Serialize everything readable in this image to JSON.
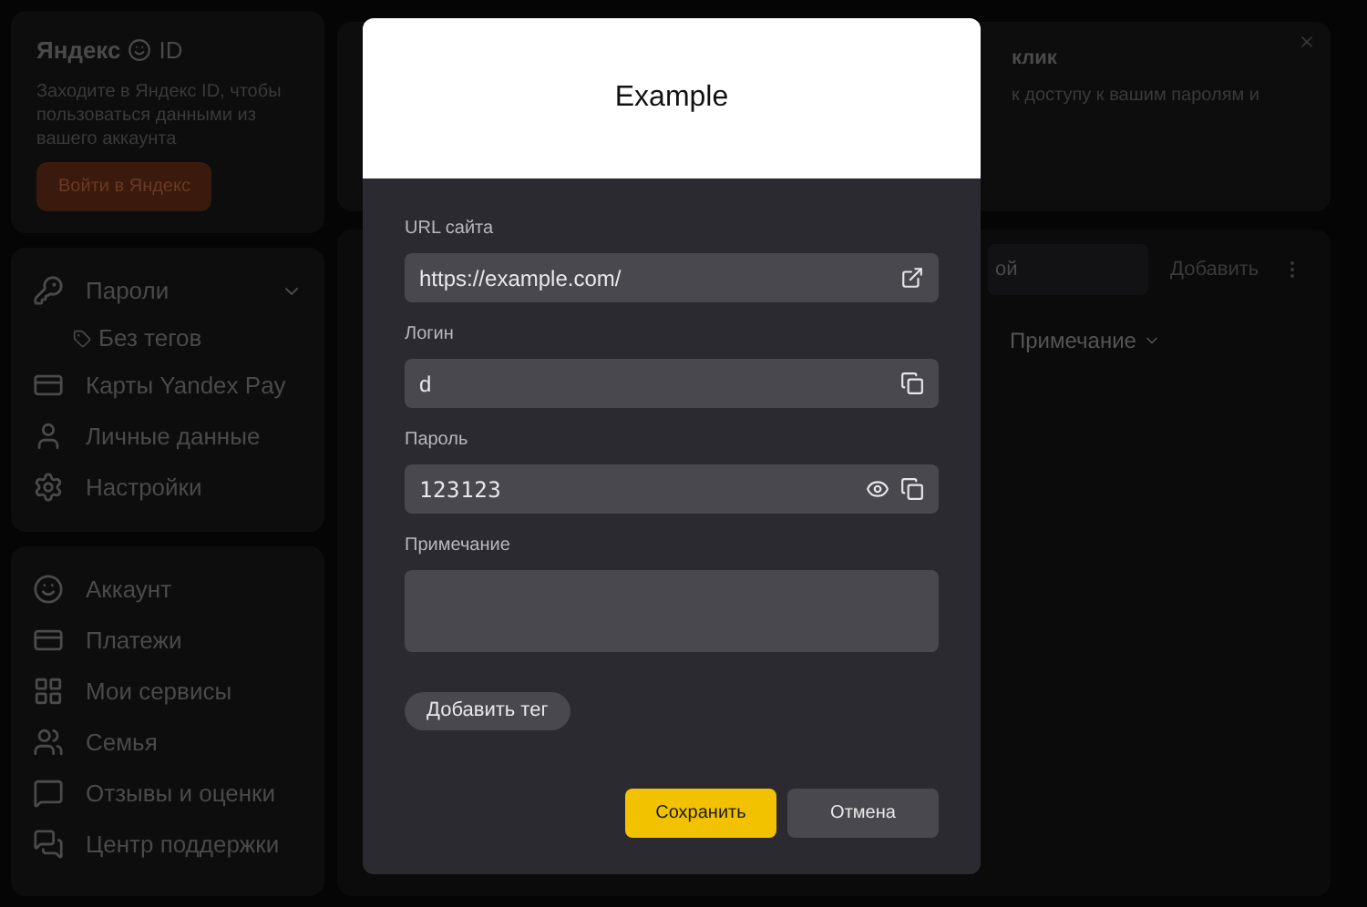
{
  "sidebar": {
    "logo": "Яндекс",
    "logo_suffix": "ID",
    "intro": "Заходите в Яндекс ID, чтобы пользоваться данными из вашего аккаунта",
    "login_button": "Войти в Яндекс",
    "items": [
      {
        "kind": "passwords",
        "label": "Пароли",
        "expanded": true,
        "children": [
          {
            "label": "Без тегов"
          }
        ]
      },
      {
        "kind": "card",
        "label": "Карты Yandex Pay"
      },
      {
        "kind": "person",
        "label": "Личные данные"
      },
      {
        "kind": "settings",
        "label": "Настройки"
      }
    ],
    "account_items": [
      {
        "kind": "account",
        "label": "Аккаунт"
      },
      {
        "kind": "card",
        "label": "Платежи"
      },
      {
        "kind": "grid",
        "label": "Мои сервисы"
      },
      {
        "kind": "family",
        "label": "Семья"
      },
      {
        "kind": "chat",
        "label": "Отзывы и оценки"
      },
      {
        "kind": "support",
        "label": "Центр поддержки"
      }
    ]
  },
  "banner": {
    "title": "клик",
    "text": "к доступу к вашим паролям и"
  },
  "toolbar": {
    "search_value": "ой",
    "add_button": "Добавить",
    "column": "Примечание"
  },
  "dialog": {
    "title": "Example",
    "fields": [
      {
        "kind": "url",
        "label": "URL сайта",
        "value": "https://example.com/"
      },
      {
        "kind": "login",
        "label": "Логин",
        "value": "d"
      },
      {
        "kind": "password",
        "label": "Пароль",
        "value": "123123"
      },
      {
        "kind": "note",
        "label": "Примечание"
      }
    ],
    "tag_button": "Добавить тег",
    "save_button": "Сохранить",
    "cancel_button": "Отмена"
  }
}
